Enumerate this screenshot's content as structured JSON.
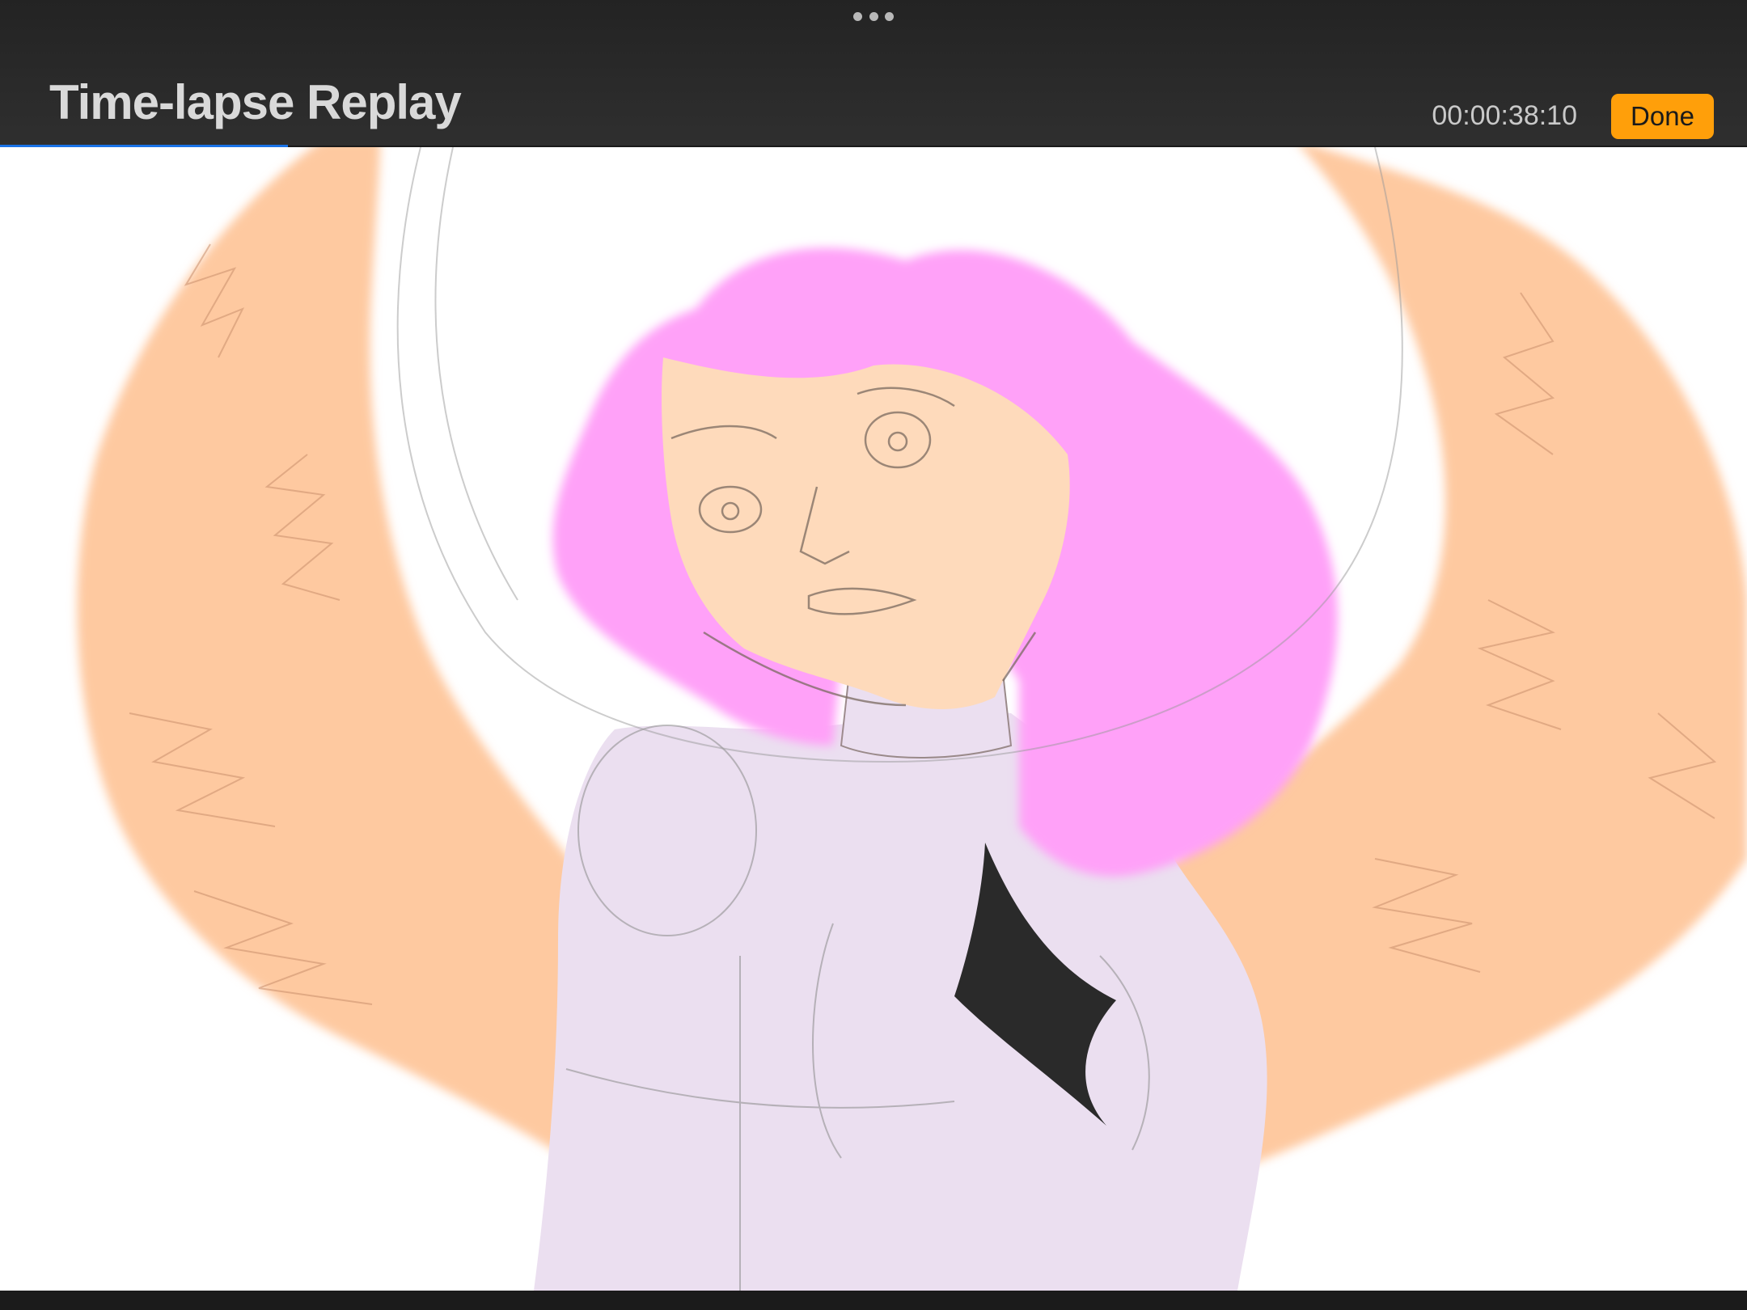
{
  "header": {
    "title": "Time-lapse Replay",
    "timecode": "00:00:38:10",
    "done_label": "Done",
    "more_icon": "ellipsis-icon"
  },
  "playback": {
    "progress": 0.165
  },
  "colors": {
    "accent_done": "#ff9f0a",
    "progress_blue": "#1a73e8",
    "hair_pink": "#ffa1f8",
    "skin": "#fedabb",
    "wings": "#fec9a0",
    "body_lavender": "#ebdff0",
    "gem_black": "#2a2a2a"
  }
}
